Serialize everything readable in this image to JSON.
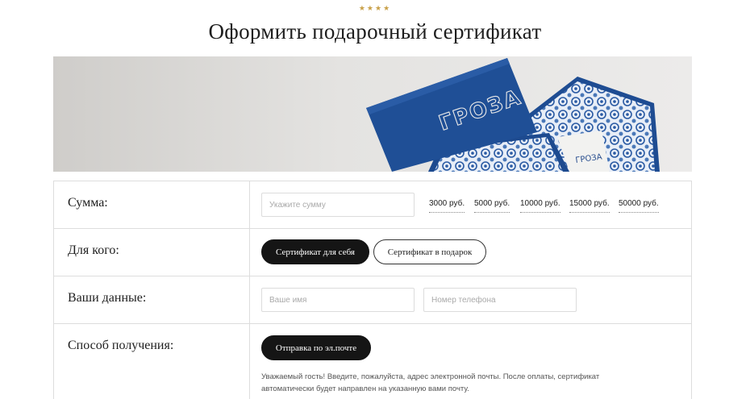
{
  "header": {
    "stars": "★★★★",
    "title": "Оформить подарочный сертификат"
  },
  "banner": {
    "brand_text": "ГРОЗА"
  },
  "form": {
    "amount": {
      "label": "Сумма:",
      "placeholder": "Укажите сумму",
      "value": "",
      "options": [
        "3000 руб.",
        "5000 руб.",
        "10000 руб.",
        "15000 руб.",
        "50000 руб."
      ]
    },
    "recipient": {
      "label": "Для кого:",
      "options": [
        {
          "label": "Сертификат для себя",
          "selected": true
        },
        {
          "label": "Сертификат в подарок",
          "selected": false
        }
      ]
    },
    "details": {
      "label": "Ваши данные:",
      "name_placeholder": "Ваше имя",
      "phone_placeholder": "Номер телефона"
    },
    "delivery": {
      "label": "Способ получения:",
      "button_label": "Отправка по эл.почте",
      "hint": "Уважаемый гость! Введите, пожалуйста, адрес электронной почты. После оплаты, сертификат автоматически будет направлен на указанную вами почту."
    }
  },
  "colors": {
    "accent_dark": "#151515",
    "stars": "#c8a048",
    "card_blue": "#1f4f96"
  }
}
